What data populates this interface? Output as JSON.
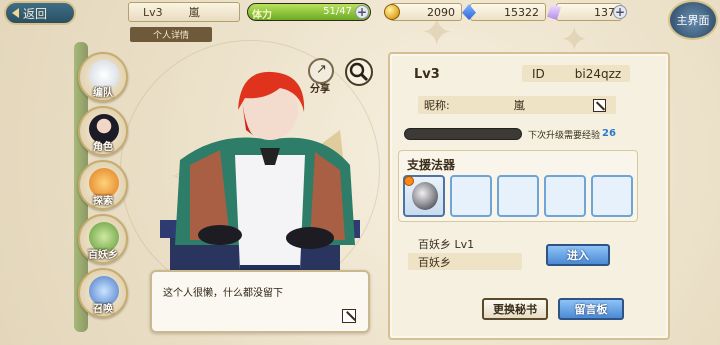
{
  "topbar": {
    "back_label": "返回",
    "level": "Lv3",
    "name": "嵐",
    "stamina_label": "体力",
    "stamina_value": "51/47",
    "stamina_fraction": 1.0,
    "gold": "2090",
    "gems": "15322",
    "crystals": "137",
    "main_label": "主界面"
  },
  "subtitle": "个人详情",
  "nav": {
    "items": [
      {
        "label": "编队",
        "icon": "ghost-icon"
      },
      {
        "label": "角色",
        "icon": "character-icon"
      },
      {
        "label": "探索",
        "icon": "explore-icon"
      },
      {
        "label": "百妖乡",
        "icon": "village-icon"
      },
      {
        "label": "召唤",
        "icon": "summon-icon"
      }
    ]
  },
  "share_label": "分享",
  "speech": "这个人很懒，什么都没留下",
  "panel": {
    "level": "Lv3",
    "id_label": "ID",
    "id_value": "bi24qzz",
    "nick_label": "昵称:",
    "nick_value": "嵐",
    "exp_label": "下次升级需要经验",
    "exp_value": "26",
    "exp_fraction": 0.0,
    "support_title": "支援法器",
    "town_line": "百妖乡  Lv1",
    "town_name": "百妖乡",
    "enter_label": "进入",
    "change_secretary": "更换秘书",
    "message_board": "留言板"
  },
  "colors": {
    "accent_blue": "#4d8ad4",
    "panel_bg": "#f6f0e1",
    "nav_label_shadow": "#3a2a10"
  }
}
